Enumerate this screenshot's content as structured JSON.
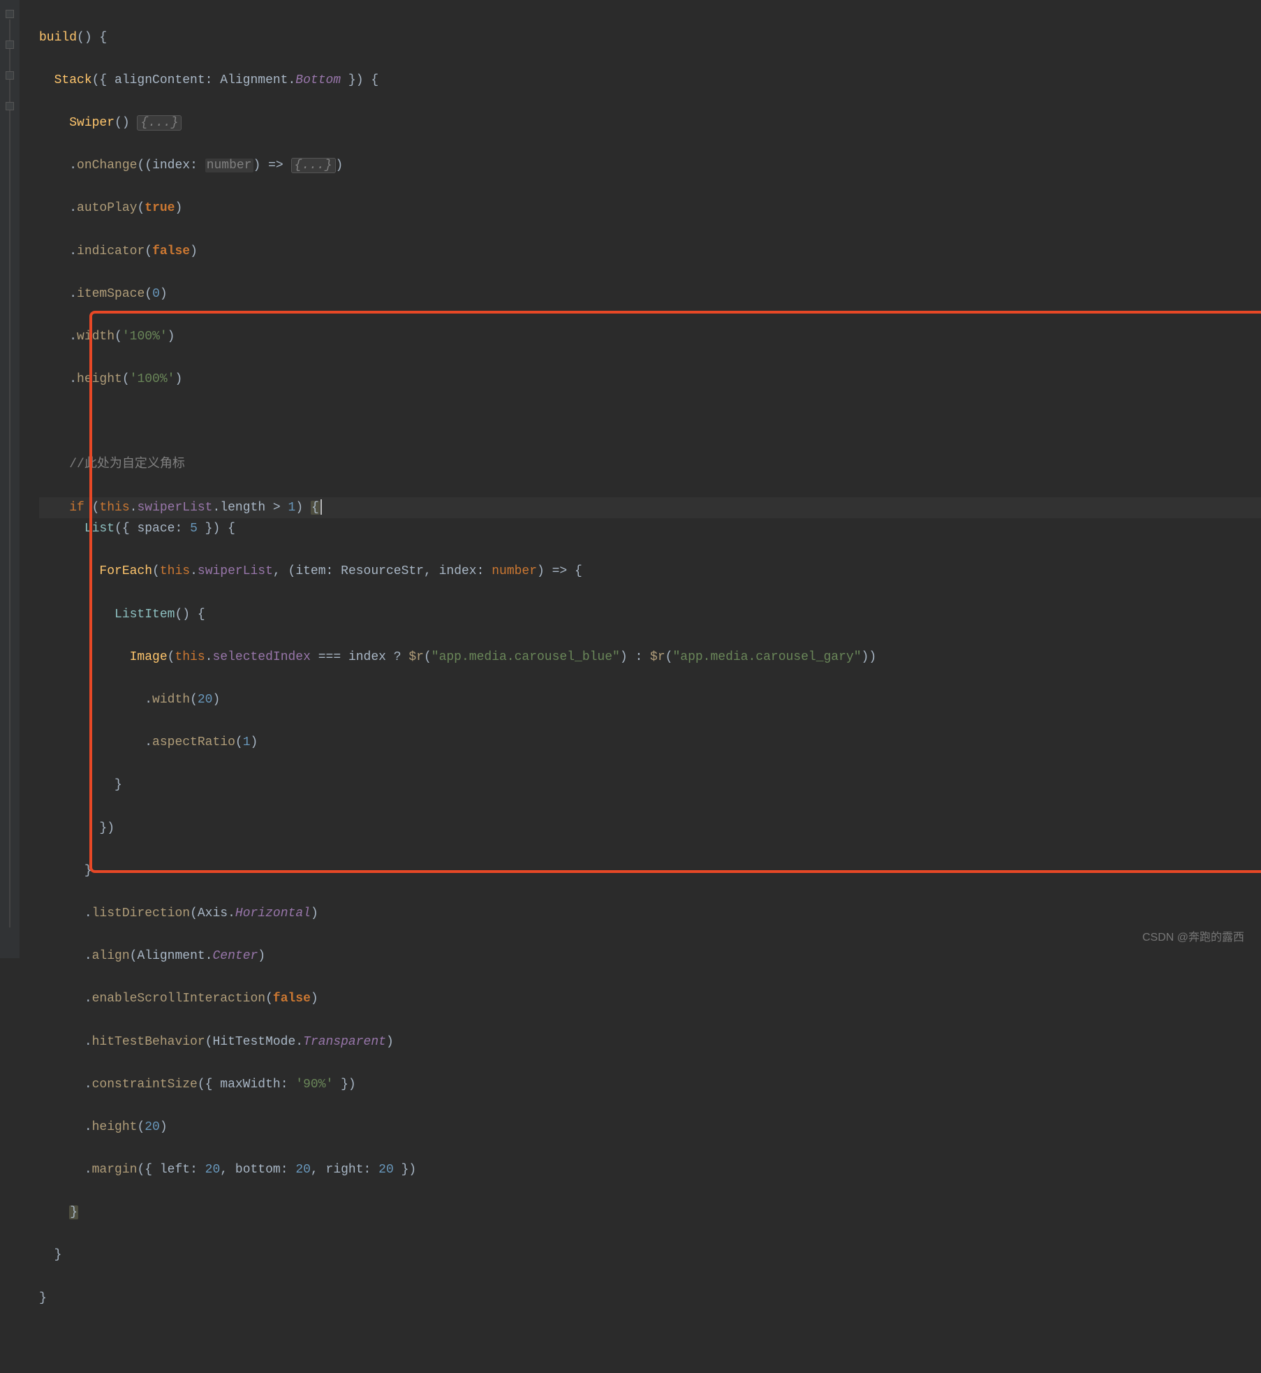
{
  "watermark": "CSDN @奔跑的露西",
  "code": {
    "l1": {
      "build": "build",
      "p1": "()",
      "brace": " {"
    },
    "l2": {
      "stack": "Stack",
      "p1": "({ ",
      "alignContent": "alignContent",
      "colon": ": ",
      "alignment": "Alignment",
      "dot": ".",
      "bottom": "Bottom",
      "p2": " }) {"
    },
    "l3": {
      "swiper": "Swiper",
      "p1": "() ",
      "folded": "{...}"
    },
    "l4": {
      "dot": ".",
      "onChange": "onChange",
      "p1": "((",
      "index": "index",
      "colon": ": ",
      "number": "number",
      "p2": ") => ",
      "folded": "{...}",
      "p3": ")"
    },
    "l5": {
      "dot": ".",
      "autoPlay": "autoPlay",
      "p1": "(",
      "true": "true",
      "p2": ")"
    },
    "l6": {
      "dot": ".",
      "indicator": "indicator",
      "p1": "(",
      "false": "false",
      "p2": ")"
    },
    "l7": {
      "dot": ".",
      "itemSpace": "itemSpace",
      "p1": "(",
      "zero": "0",
      "p2": ")"
    },
    "l8": {
      "dot": ".",
      "width": "width",
      "p1": "(",
      "str": "'100%'",
      "p2": ")"
    },
    "l9": {
      "dot": ".",
      "height": "height",
      "p1": "(",
      "str": "'100%'",
      "p2": ")"
    },
    "l11": {
      "comment": "//此处为自定义角标"
    },
    "l12": {
      "if": "if",
      "p1": " (",
      "this": "this",
      "d1": ".",
      "swiperList": "swiperList",
      "d2": ".",
      "length": "length",
      "gt": " > ",
      "one": "1",
      "p2": ") ",
      "brace": "{"
    },
    "l13": {
      "list": "List",
      "p1": "({ ",
      "space": "space",
      "colon": ": ",
      "five": "5",
      "p2": " }) {"
    },
    "l14": {
      "foreach": "ForEach",
      "p1": "(",
      "this": "this",
      "d1": ".",
      "swiperList": "swiperList",
      "comma": ", (",
      "item": "item",
      "c1": ": ",
      "res": "ResourceStr",
      "comma2": ", ",
      "index": "index",
      "c2": ": ",
      "number": "number",
      "p2": ") => {"
    },
    "l15": {
      "listItem": "ListItem",
      "p1": "() {"
    },
    "l16": {
      "image": "Image",
      "p1": "(",
      "this": "this",
      "d1": ".",
      "selectedIndex": "selectedIndex",
      "eq": " === ",
      "index": "index",
      "q": " ? ",
      "r1": "$r",
      "p2": "(",
      "s1": "\"app.media.carousel_blue\"",
      "p3": ")",
      "colon": " : ",
      "r2": "$r",
      "p4": "(",
      "s2": "\"app.media.carousel_gary\"",
      "p5": "))"
    },
    "l17": {
      "dot": ".",
      "width": "width",
      "p1": "(",
      "n": "20",
      "p2": ")"
    },
    "l18": {
      "dot": ".",
      "aspectRatio": "aspectRatio",
      "p1": "(",
      "n": "1",
      "p2": ")"
    },
    "l19": {
      "brace": "}"
    },
    "l20": {
      "brace": "})"
    },
    "l21": {
      "brace": "}"
    },
    "l22": {
      "dot": ".",
      "listDirection": "listDirection",
      "p1": "(",
      "axis": "Axis",
      "d1": ".",
      "horiz": "Horizontal",
      "p2": ")"
    },
    "l23": {
      "dot": ".",
      "align": "align",
      "p1": "(",
      "alignment": "Alignment",
      "d1": ".",
      "center": "Center",
      "p2": ")"
    },
    "l24": {
      "dot": ".",
      "esi": "enableScrollInteraction",
      "p1": "(",
      "false": "false",
      "p2": ")"
    },
    "l25": {
      "dot": ".",
      "htb": "hitTestBehavior",
      "p1": "(",
      "htm": "HitTestMode",
      "d1": ".",
      "transp": "Transparent",
      "p2": ")"
    },
    "l26": {
      "dot": ".",
      "cs": "constraintSize",
      "p1": "({ ",
      "maxWidth": "maxWidth",
      "colon": ": ",
      "str": "'90%'",
      "p2": " })"
    },
    "l27": {
      "dot": ".",
      "height": "height",
      "p1": "(",
      "n": "20",
      "p2": ")"
    },
    "l28": {
      "dot": ".",
      "margin": "margin",
      "p1": "({ ",
      "left": "left",
      "c1": ": ",
      "n1": "20",
      "comma1": ", ",
      "bottom": "bottom",
      "c2": ": ",
      "n2": "20",
      "comma2": ", ",
      "right": "right",
      "c3": ": ",
      "n3": "20",
      "p2": " })"
    },
    "l29": {
      "brace": "}"
    },
    "l30": {
      "brace": "}"
    },
    "l31": {
      "brace": "}"
    }
  }
}
